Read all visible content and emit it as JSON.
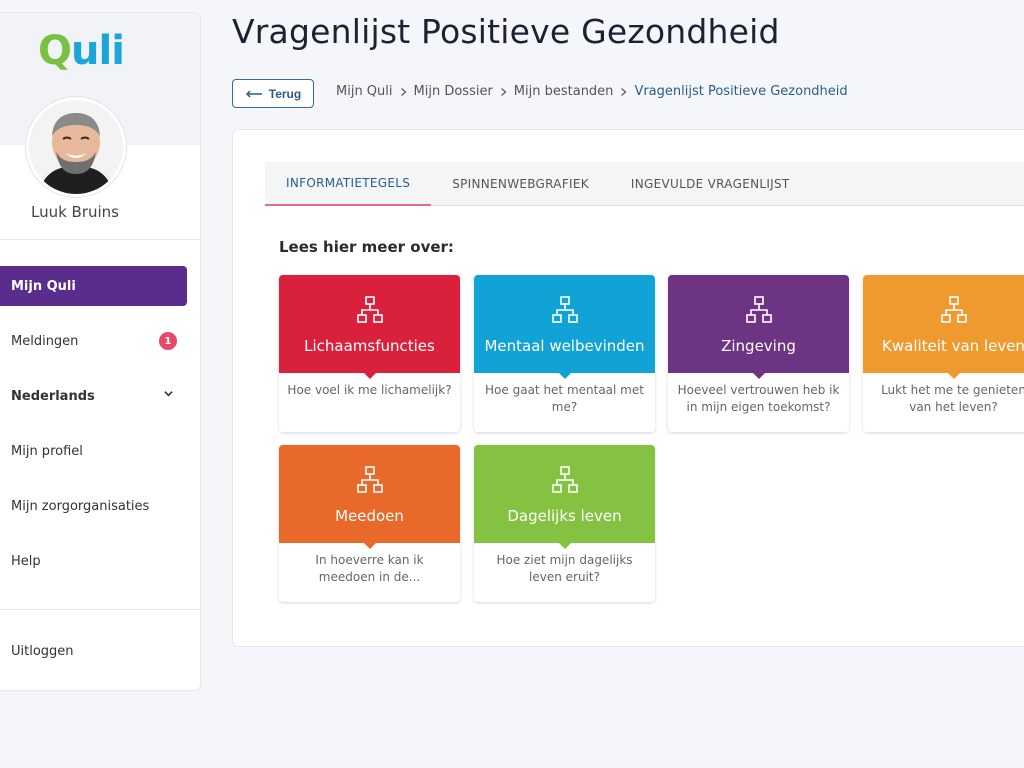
{
  "sidebar": {
    "logo_q": "Q",
    "logo_rest": "uli",
    "user_name": "Luuk Bruins",
    "nav": [
      {
        "label": "Mijn Quli",
        "active": true
      },
      {
        "label": "Meldingen",
        "badge": "1"
      },
      {
        "label": "Nederlands"
      },
      {
        "label": "Mijn profiel"
      },
      {
        "label": "Mijn zorgorganisaties"
      },
      {
        "label": "Help"
      }
    ],
    "logout": "Uitloggen"
  },
  "header": {
    "title": "Vragenlijst Positieve Gezondheid",
    "back_label": "Terug",
    "breadcrumb": [
      "Mijn Quli",
      "Mijn Dossier",
      "Mijn bestanden",
      "Vragenlijst Positieve Gezondheid"
    ]
  },
  "tabs": [
    "INFORMATIETEGELS",
    "SPINNENWEBGRAFIEK",
    "INGEVULDE VRAGENLIJST"
  ],
  "section_label": "Lees hier meer over:",
  "tiles": [
    {
      "title": "Lichaamsfuncties",
      "desc": "Hoe voel ik me lichamelijk?",
      "color": "#d9213b"
    },
    {
      "title": "Mentaal welbevinden",
      "desc": "Hoe gaat het mentaal met me?",
      "color": "#12a3d6"
    },
    {
      "title": "Zingeving",
      "desc": "Hoeveel vertrouwen heb ik in mijn eigen toekomst?",
      "color": "#6e3484"
    },
    {
      "title": "Kwaliteit van leven",
      "desc": "Lukt het me te genieten van het leven?",
      "color": "#ee9a2e"
    },
    {
      "title": "Meedoen",
      "desc": "In hoeverre kan ik meedoen in de...",
      "color": "#e8692a"
    },
    {
      "title": "Dagelijks leven",
      "desc": "Hoe ziet mijn dagelijks leven eruit?",
      "color": "#86c241"
    }
  ],
  "colors": {
    "primary_purple": "#5a2d8c",
    "link_blue": "#2a5c8a",
    "badge_red": "#e64a6a",
    "tab_underline": "#e86a8e"
  }
}
